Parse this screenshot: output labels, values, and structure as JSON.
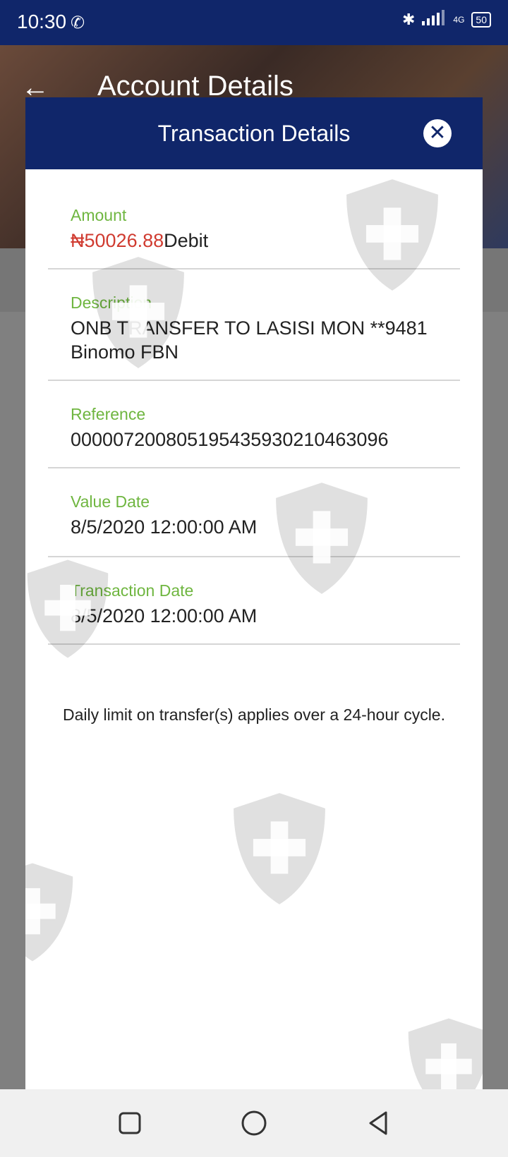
{
  "status_bar": {
    "time": "10:30",
    "call_icon": "missed-call-icon",
    "network": "4G",
    "battery": "50",
    "icons": [
      "bluetooth-icon",
      "signal-icon",
      "battery-icon"
    ]
  },
  "app_header": {
    "back_icon": "back-arrow-icon",
    "title": "Account Details"
  },
  "modal": {
    "title": "Transaction Details",
    "close_icon": "close-icon",
    "fields": [
      {
        "label": "Amount",
        "currency": "₦",
        "amount": "50026.88",
        "type": "Debit"
      },
      {
        "label": "Description",
        "value": "ONB TRANSFER TO LASISI MON **9481 Binomo FBN"
      },
      {
        "label": "Reference",
        "value": "000007200805195435930210463096"
      },
      {
        "label": "Value Date",
        "value": "8/5/2020 12:00:00 AM"
      },
      {
        "label": "Transaction Date",
        "value": "8/5/2020 12:00:00 AM"
      }
    ],
    "note": "Daily limit on transfer(s) applies over a 24-hour cycle."
  },
  "nav_bar": {
    "buttons": [
      "recent-apps-icon",
      "home-icon",
      "back-icon"
    ]
  },
  "colors": {
    "primary": "#10266a",
    "label_green": "#6fb640",
    "amount_red": "#d03b30"
  }
}
